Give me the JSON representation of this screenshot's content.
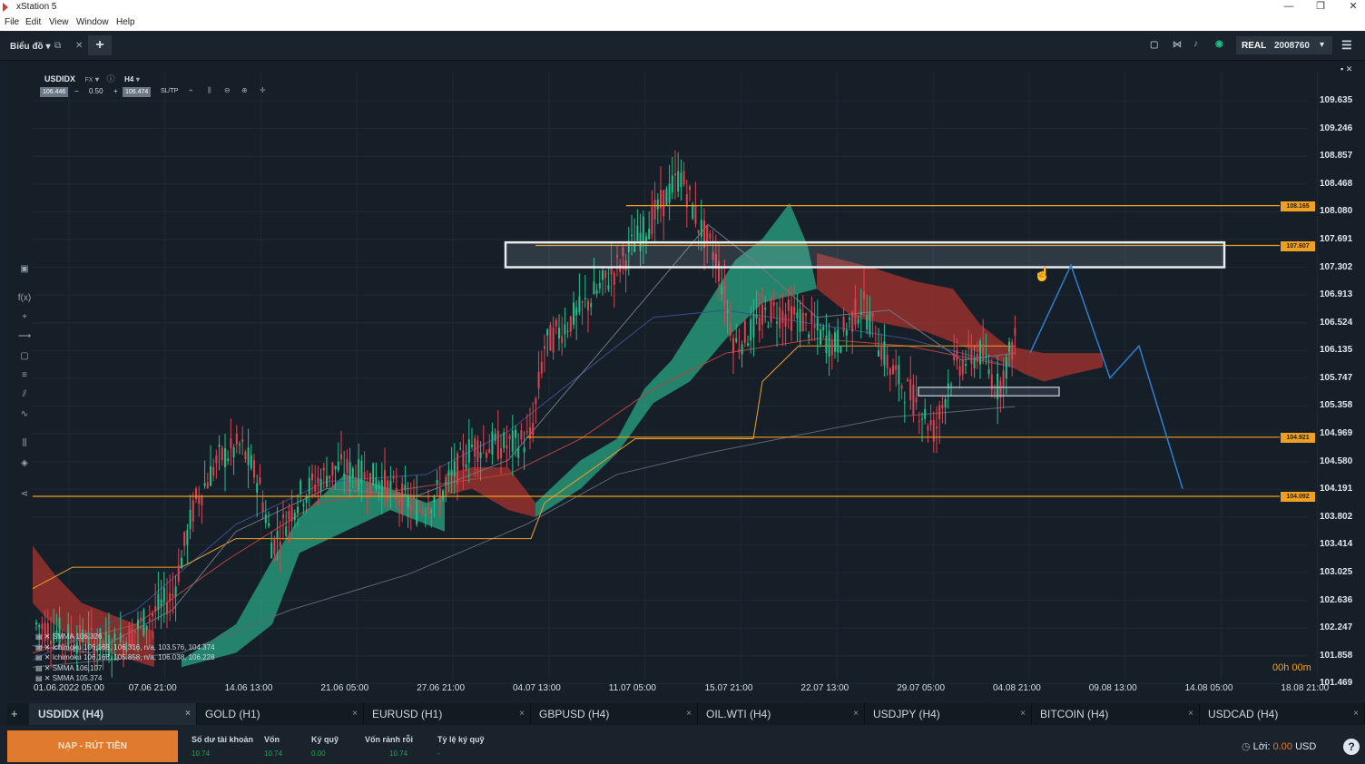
{
  "window": {
    "title": "xStation 5",
    "minimize": "—",
    "restore": "❐",
    "close": "✕"
  },
  "menu": [
    "File",
    "Edit",
    "View",
    "Window",
    "Help"
  ],
  "topbar": {
    "section_label": "Biểu đồ",
    "add_tab": "+",
    "account_type": "REAL",
    "account_number": "2008760"
  },
  "chart_header": {
    "symbol": "USDIDX",
    "market": "FX",
    "timeframe": "H4",
    "sell_price": "106.446",
    "volume": "0.50",
    "buy_price": "106.474",
    "sltp": "SL/TP",
    "minus": "−",
    "plus": "+"
  },
  "colors": {
    "bull": "#1fc08a",
    "bear": "#e0424d",
    "level": "#f0a020",
    "forecast": "#2f7fd0",
    "cloud_bull": "#2aa582",
    "cloud_bear": "#a8332f"
  },
  "chart_data": {
    "type": "candlestick",
    "symbol": "USDIDX",
    "timeframe": "H4",
    "y_ticks": [
      "109.635",
      "109.246",
      "108.857",
      "108.468",
      "108.080",
      "107.691",
      "107.302",
      "106.913",
      "106.524",
      "106.135",
      "105.747",
      "105.358",
      "104.969",
      "104.580",
      "104.191",
      "103.802",
      "103.414",
      "103.025",
      "102.636",
      "102.247",
      "101.858",
      "101.469"
    ],
    "x_ticks": [
      "01.06.2022 05:00",
      "07.06 21:00",
      "14.06 13:00",
      "21.06 05:00",
      "27.06 21:00",
      "04.07 13:00",
      "11.07 05:00",
      "15.07 21:00",
      "22.07 13:00",
      "29.07 05:00",
      "04.08 21:00",
      "09.08 13:00",
      "14.08 05:00",
      "18.08 21:00"
    ],
    "levels": [
      "108.165",
      "107.607",
      "104.921",
      "104.092"
    ],
    "zone": {
      "from": 107.302,
      "to": 107.65
    },
    "small_zone": {
      "from": 105.5,
      "to": 105.62
    },
    "forecast_path": [
      106.1,
      107.33,
      105.75,
      106.2,
      104.2
    ],
    "indicators": [
      "SMMA 106.326",
      "Ichimoku 106.168, 106.316, n/a, 103.576, 104.374",
      "Ichimoku 106.168, 105.858, n/a, 106.038, 106.228",
      "SMMA 106.107",
      "SMMA 105.374"
    ],
    "timer": "00h 00m"
  },
  "tabs": [
    {
      "label": "USDIDX (H4)"
    },
    {
      "label": "GOLD (H1)"
    },
    {
      "label": "EURUSD (H1)"
    },
    {
      "label": "GBPUSD (H4)"
    },
    {
      "label": "OIL.WTI (H4)"
    },
    {
      "label": "USDJPY (H4)"
    },
    {
      "label": "BITCOIN (H4)"
    },
    {
      "label": "USDCAD (H4)"
    }
  ],
  "tab_close": "×",
  "account": {
    "deposit_button": "NẠP - RÚT TIỀN",
    "fields": [
      {
        "label": "Số dư tài khoản",
        "value": "10.74"
      },
      {
        "label": "Vốn",
        "value": "10.74"
      },
      {
        "label": "Ký quỹ",
        "value": "0.00"
      },
      {
        "label": "Vốn rảnh rỗi",
        "value": "10.74"
      },
      {
        "label": "Tỷ lệ ký quỹ",
        "value": "-"
      }
    ],
    "profit_label": "Lời:",
    "profit_value": "0.00",
    "currency": "USD",
    "help": "?"
  }
}
